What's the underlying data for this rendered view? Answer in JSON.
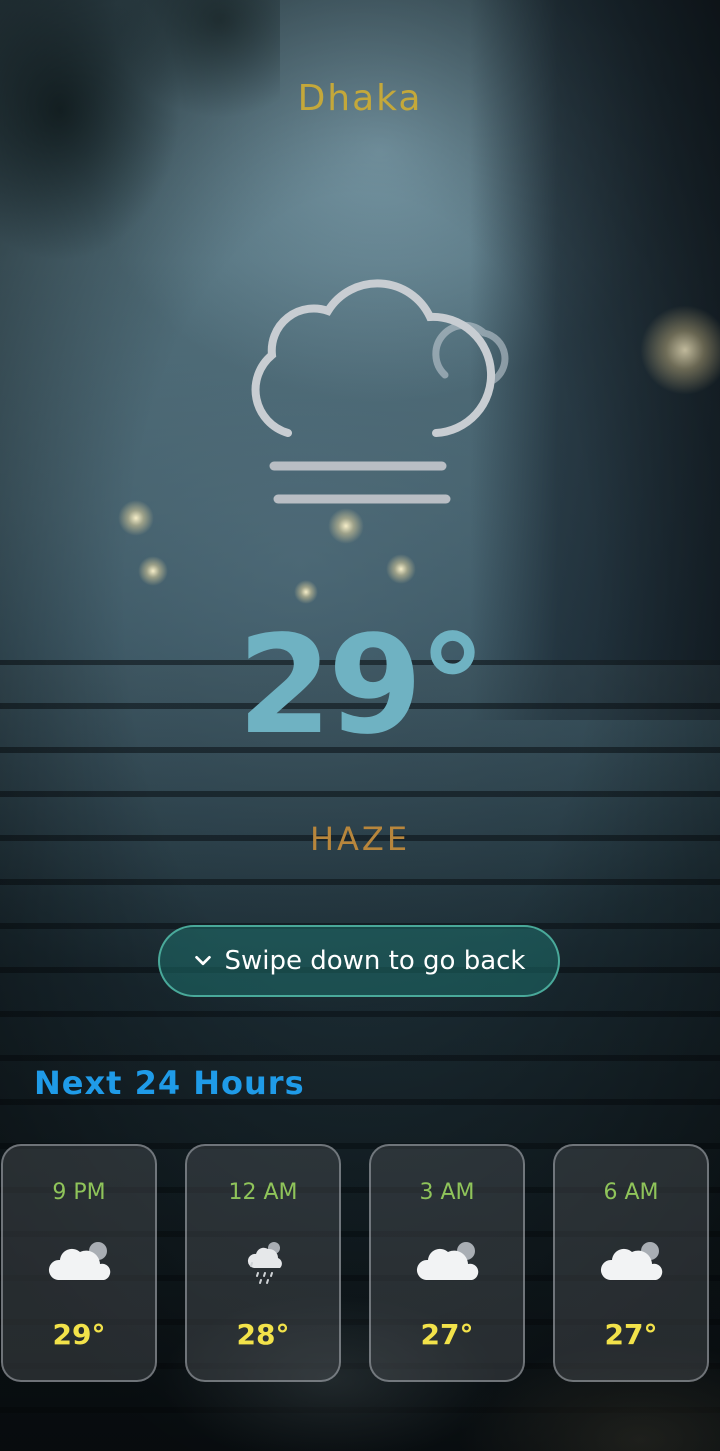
{
  "location": {
    "city": "Dhaka"
  },
  "current": {
    "icon": "haze-cloud-icon",
    "temperature": "29°",
    "condition": "HAZE"
  },
  "navigation": {
    "swipe_label": "Swipe down to go back",
    "icon": "chevron-down-icon"
  },
  "forecast": {
    "title": "Next 24 Hours",
    "items": [
      {
        "time": "9 PM",
        "temp": "29°",
        "icon": "partly-cloudy-icon"
      },
      {
        "time": "12 AM",
        "temp": "28°",
        "icon": "cloud-rain-icon"
      },
      {
        "time": "3 AM",
        "temp": "27°",
        "icon": "partly-cloudy-icon"
      },
      {
        "time": "6 AM",
        "temp": "27°",
        "icon": "partly-cloudy-icon"
      }
    ]
  },
  "colors": {
    "city": "#c4a83a",
    "temperature": "#6fb2c2",
    "condition": "#b8863c",
    "section_title": "#1f9be8",
    "forecast_time": "#8fc45a",
    "forecast_temp": "#f2e24a",
    "swipe_border": "#5ac8b4"
  }
}
